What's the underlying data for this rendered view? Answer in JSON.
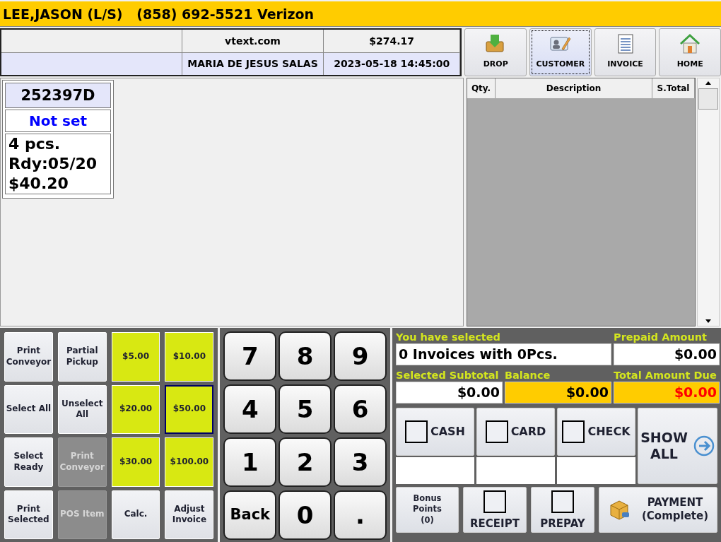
{
  "header": {
    "customer_line": "LEE,JASON (L/S)   (858) 692-5521 Verizon"
  },
  "info_table": {
    "rows": [
      {
        "column_2": "vtext.com",
        "column_3": "$274.17"
      },
      {
        "column_2": "MARIA DE JESUS SALAS",
        "column_3": "2023-05-18 14:45:00"
      }
    ]
  },
  "nav_buttons": [
    {
      "label": "DROP",
      "kind": "drop",
      "selected": false
    },
    {
      "label": "CUSTOMER",
      "kind": "customer",
      "selected": true
    },
    {
      "label": "INVOICE",
      "kind": "invoice",
      "selected": false
    },
    {
      "label": "HOME",
      "kind": "home",
      "selected": false
    }
  ],
  "invoices": [
    {
      "number": "252397D",
      "status": "Not set",
      "details": [
        "4 pcs.",
        "Rdy:05/20",
        "$40.20"
      ]
    }
  ],
  "items_table": {
    "columns": [
      "Qty.",
      "Description",
      "S.Total"
    ]
  },
  "action_buttons": [
    {
      "label": "Print Conveyor",
      "kind": "action",
      "disabled": false,
      "focused": false
    },
    {
      "label": "Partial Pickup",
      "kind": "action",
      "disabled": false,
      "focused": false
    },
    {
      "label": "$5.00",
      "kind": "cash",
      "disabled": false,
      "focused": false
    },
    {
      "label": "$10.00",
      "kind": "cash",
      "disabled": false,
      "focused": false
    },
    {
      "label": "Select All",
      "kind": "action",
      "disabled": false,
      "focused": false
    },
    {
      "label": "Unselect All",
      "kind": "action",
      "disabled": false,
      "focused": false
    },
    {
      "label": "$20.00",
      "kind": "cash",
      "disabled": false,
      "focused": false
    },
    {
      "label": "$50.00",
      "kind": "cash",
      "disabled": false,
      "focused": true
    },
    {
      "label": "Select Ready",
      "kind": "action",
      "disabled": false,
      "focused": false
    },
    {
      "label": "Print Conveyor",
      "kind": "action",
      "disabled": true,
      "focused": false
    },
    {
      "label": "$30.00",
      "kind": "cash",
      "disabled": false,
      "focused": false
    },
    {
      "label": "$100.00",
      "kind": "cash",
      "disabled": false,
      "focused": false
    },
    {
      "label": "Print Selected",
      "kind": "action",
      "disabled": false,
      "focused": false
    },
    {
      "label": "POS Item",
      "kind": "action",
      "disabled": true,
      "focused": false
    },
    {
      "label": "Calc.",
      "kind": "action",
      "disabled": false,
      "focused": false
    },
    {
      "label": "Adjust Invoice",
      "kind": "action",
      "disabled": false,
      "focused": false
    }
  ],
  "keypad": [
    "7",
    "8",
    "9",
    "4",
    "5",
    "6",
    "1",
    "2",
    "3",
    "Back",
    "0",
    "."
  ],
  "summary": {
    "selected_label": "You have selected",
    "selected_value": "0 Invoices with 0Pcs.",
    "prepaid_label": "Prepaid Amount",
    "prepaid_value": "$0.00",
    "subtotal_label": "Selected Subtotal",
    "subtotal_value": "$0.00",
    "balance_label": "Balance",
    "balance_value": "$0.00",
    "due_label": "Total Amount Due",
    "due_value": "$0.00"
  },
  "payment_methods": [
    {
      "label": "CASH",
      "checked": false
    },
    {
      "label": "CARD",
      "checked": false
    },
    {
      "label": "CHECK",
      "checked": false
    }
  ],
  "show_all": {
    "label_lines": [
      "SHOW",
      "ALL"
    ]
  },
  "bonus_button": {
    "lines": [
      "Bonus",
      "Points",
      "(0)"
    ]
  },
  "options": [
    {
      "label": "RECEIPT",
      "checked": false
    },
    {
      "label": "PREPAY",
      "checked": false
    }
  ],
  "payment_button": {
    "lines": [
      "PAYMENT",
      "(Complete)"
    ]
  }
}
